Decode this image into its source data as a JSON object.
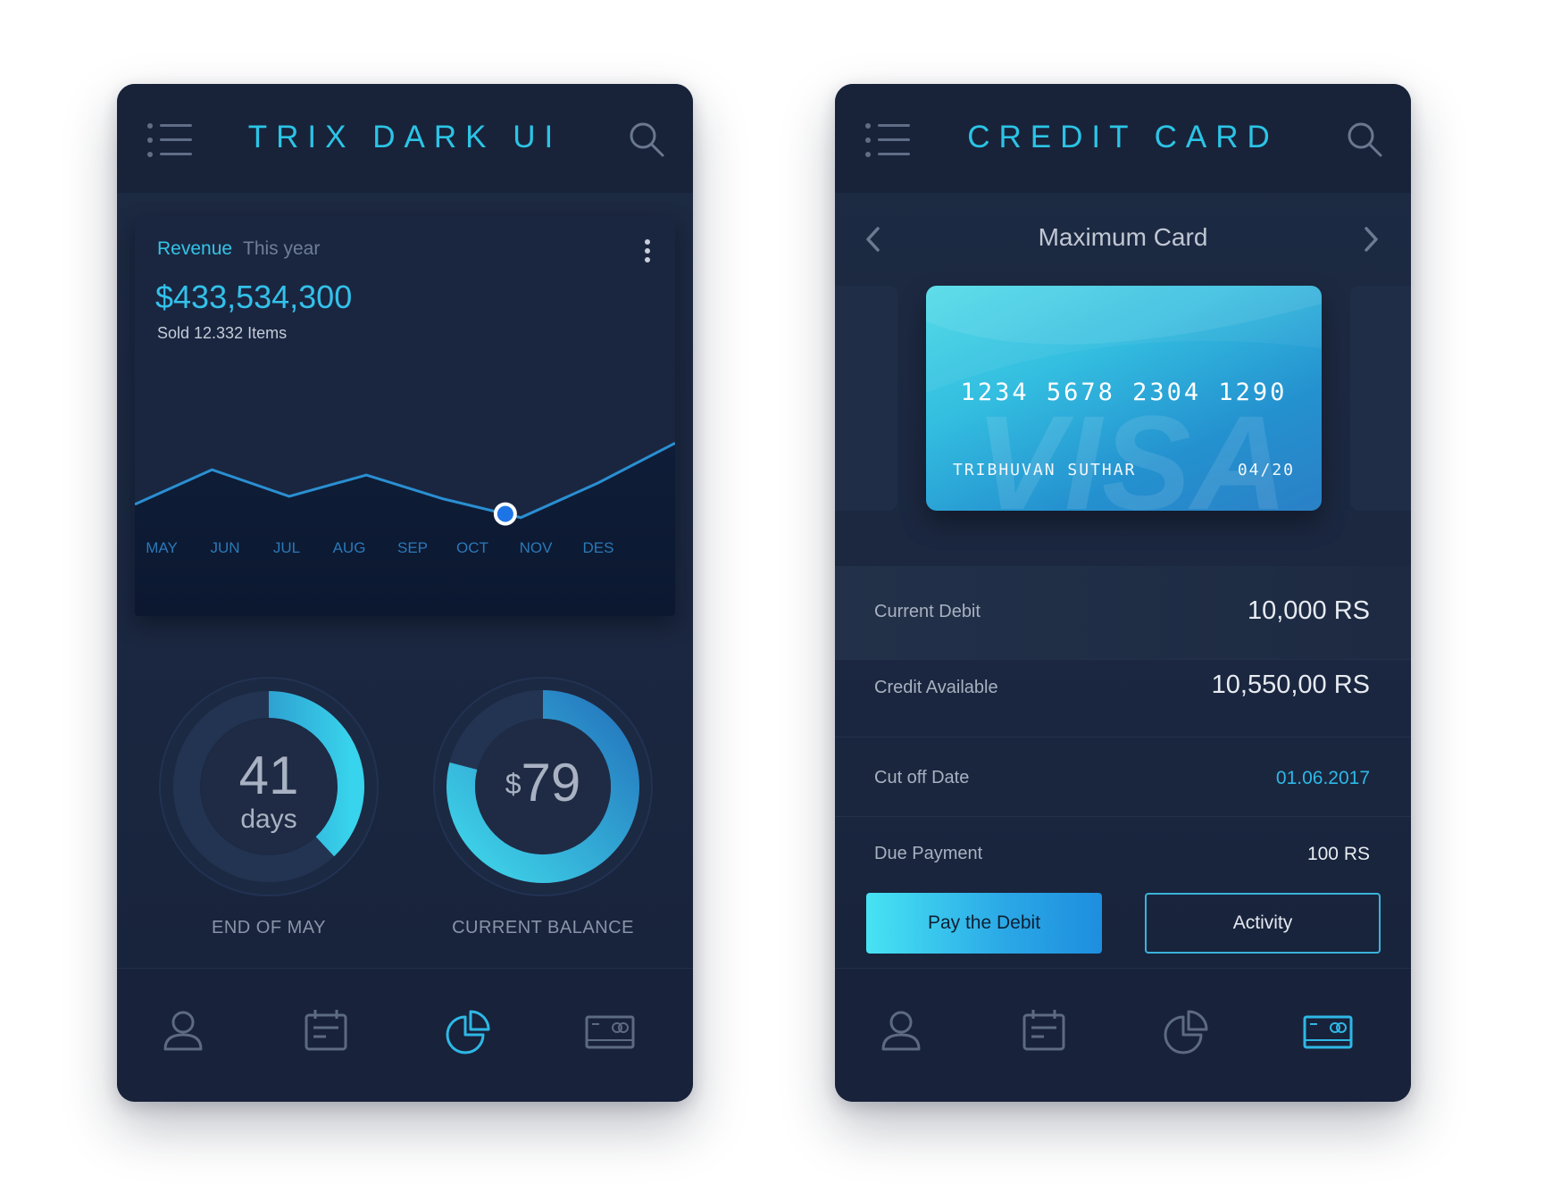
{
  "left_screen": {
    "title": "TRIX DARK UI",
    "revenue": {
      "label": "Revenue",
      "period": "This year",
      "amount": "$433,534,300",
      "sold": "Sold 12.332 Items"
    },
    "rings": {
      "days": {
        "value": "41",
        "unit": "days",
        "caption": "END OF MAY",
        "progress": 0.38
      },
      "balance": {
        "currency": "$",
        "value": "79",
        "caption": "CURRENT BALANCE",
        "progress": 0.79
      }
    },
    "nav": {
      "active": "chart"
    }
  },
  "right_screen": {
    "title": "CREDIT CARD",
    "card_title": "Maximum Card",
    "card": {
      "number": "1234 5678 2304 1290",
      "holder": "TRIBHUVAN SUTHAR",
      "expiry": "04/20",
      "brand": "VISA"
    },
    "details": [
      {
        "label": "Current Debit",
        "value": "10,000 RS"
      },
      {
        "label": "Credit Available",
        "value": "10,550,00 RS"
      },
      {
        "label": "Cut off Date",
        "value": "01.06.2017"
      },
      {
        "label": "Due Payment",
        "value": "100 RS"
      }
    ],
    "buttons": {
      "pay": "Pay the Debit",
      "activity": "Activity"
    },
    "nav": {
      "active": "card"
    }
  },
  "chart_data": {
    "type": "area",
    "categories": [
      "MAY",
      "JUN",
      "JUL",
      "AUG",
      "SEP",
      "OCT",
      "NOV",
      "DES"
    ],
    "values": [
      42,
      55,
      45,
      53,
      44,
      37,
      50,
      65
    ],
    "highlight_index": 5,
    "ylim": [
      0,
      100
    ]
  },
  "colors": {
    "accent": "#2cc4e6",
    "background": "#1b2740",
    "line": "#2a8fd2",
    "card_gradient_start": "#49d9e6",
    "card_gradient_end": "#2a80c6"
  }
}
